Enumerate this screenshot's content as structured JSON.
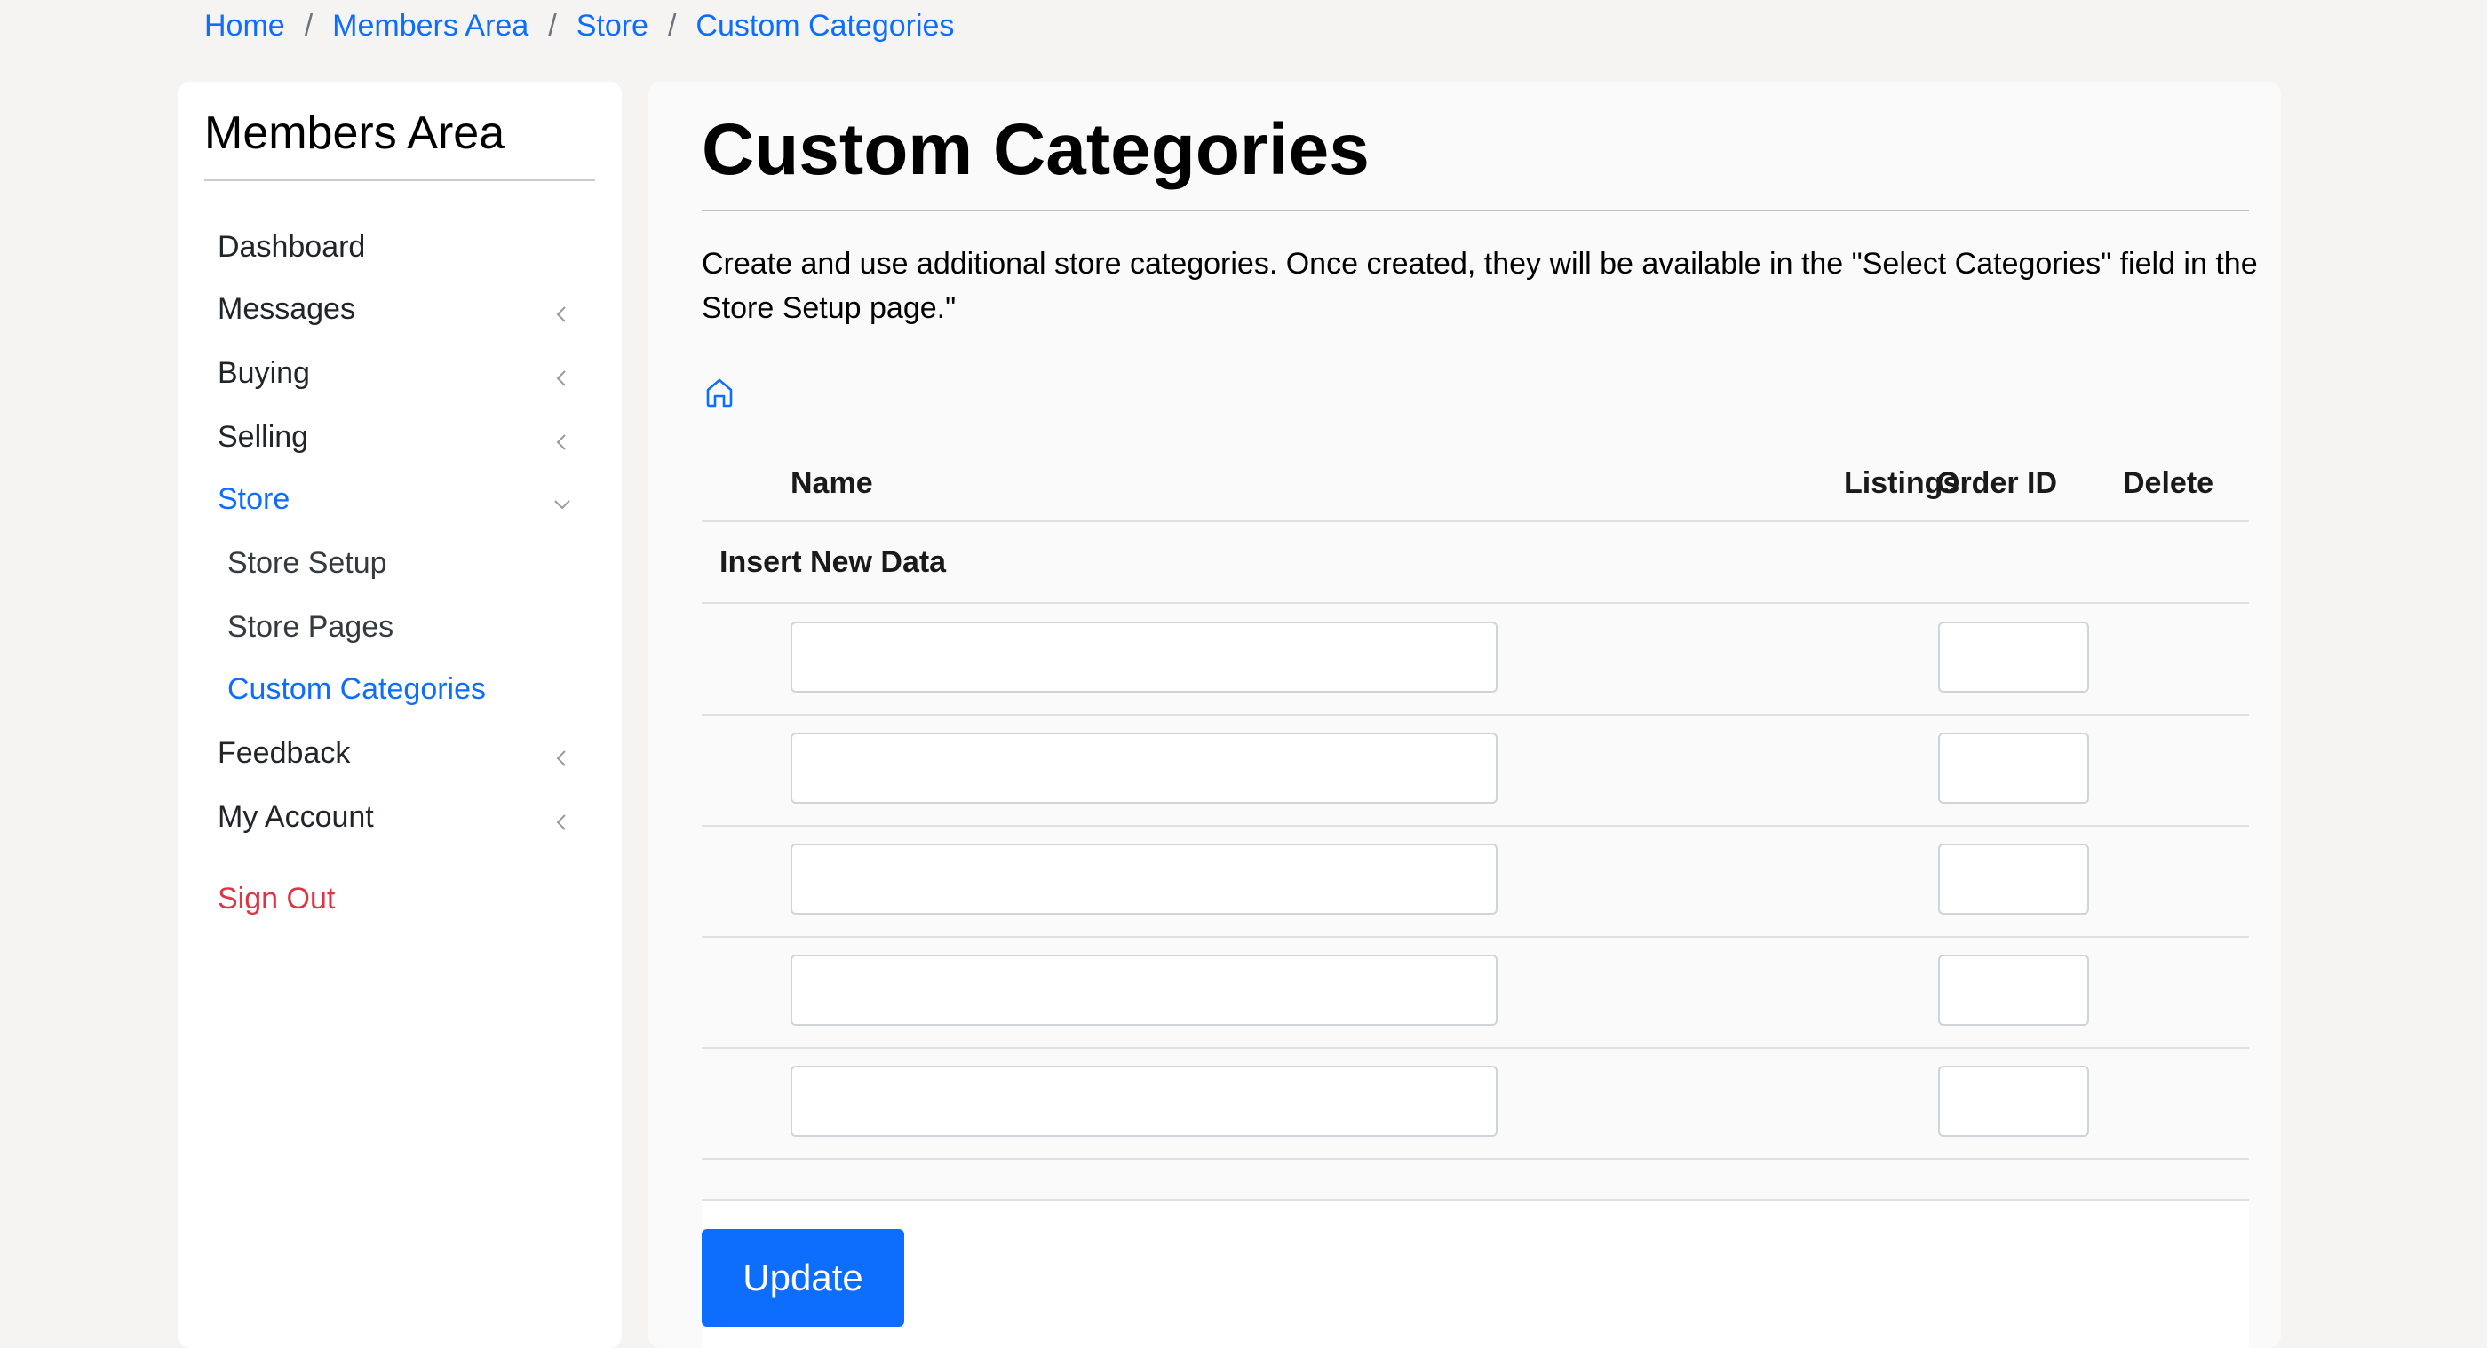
{
  "breadcrumb": [
    "Home",
    "Members Area",
    "Store",
    "Custom Categories"
  ],
  "breadcrumb_separator": "/",
  "sidebar": {
    "title": "Members Area",
    "items": [
      {
        "label": "Dashboard",
        "chevron": "none"
      },
      {
        "label": "Messages",
        "chevron": "left"
      },
      {
        "label": "Buying",
        "chevron": "left"
      },
      {
        "label": "Selling",
        "chevron": "left"
      },
      {
        "label": "Store",
        "chevron": "down",
        "active": true
      },
      {
        "label": "Store Setup",
        "sub": true
      },
      {
        "label": "Store Pages",
        "sub": true
      },
      {
        "label": "Custom Categories",
        "sub": true,
        "active": true
      },
      {
        "label": "Feedback",
        "chevron": "left"
      },
      {
        "label": "My Account",
        "chevron": "left"
      }
    ],
    "signout": "Sign Out"
  },
  "main": {
    "title": "Custom Categories",
    "description": "Create and use additional store categories. Once created, they will be available in the \"Select Categories\" field in the Store Setup page.\"",
    "table": {
      "headers": {
        "name": "Name",
        "listings": "Listings",
        "order_id": "Order ID",
        "delete": "Delete"
      },
      "insert_label": "Insert New Data",
      "rows": [
        {
          "name": "",
          "order_id": ""
        },
        {
          "name": "",
          "order_id": ""
        },
        {
          "name": "",
          "order_id": ""
        },
        {
          "name": "",
          "order_id": ""
        },
        {
          "name": "",
          "order_id": ""
        }
      ]
    },
    "update_label": "Update"
  },
  "colors": {
    "accent": "#0d6efd",
    "signout": "#dc3545",
    "background": "#f5f4f3"
  },
  "icons": {
    "home": "home-icon",
    "chevron_left": "chevron-left-icon",
    "chevron_down": "chevron-down-icon"
  }
}
